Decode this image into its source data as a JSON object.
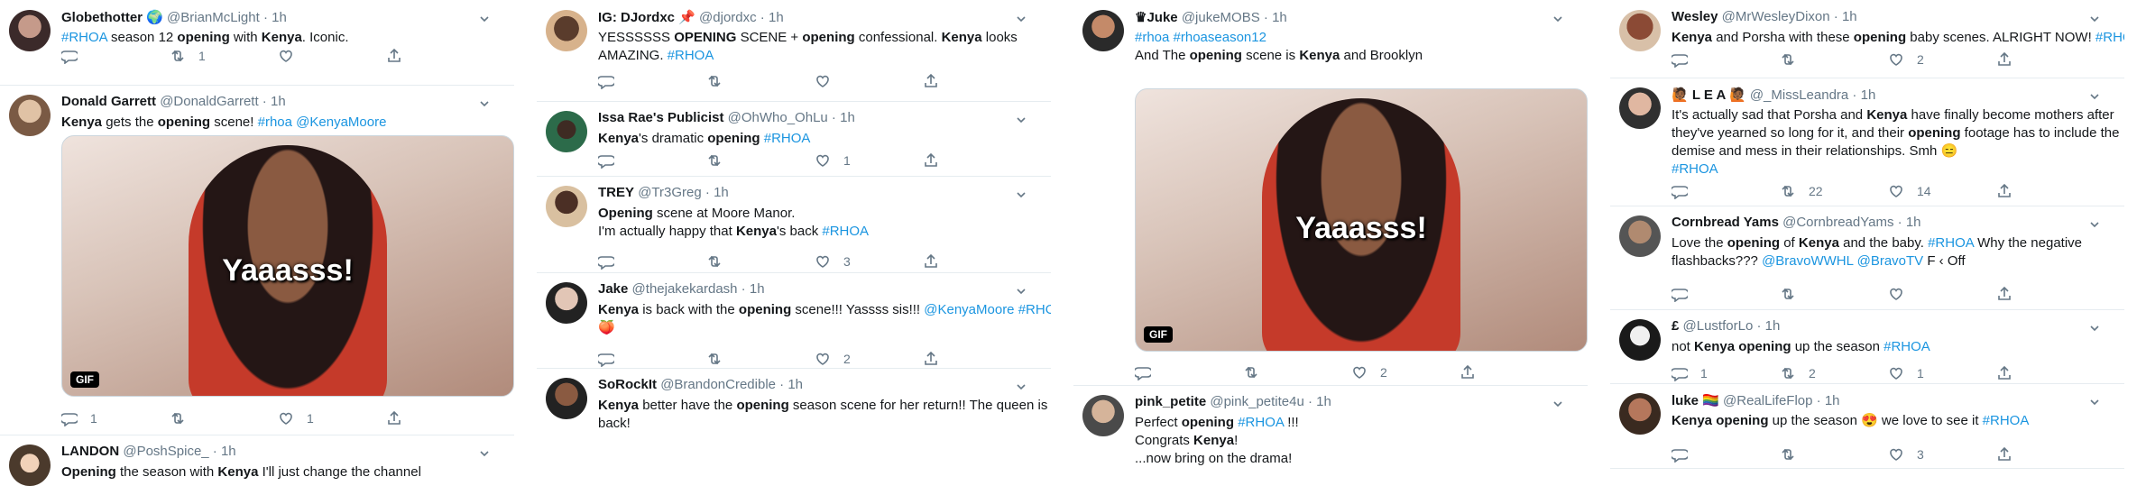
{
  "columns": [
    {
      "tweets": [
        {
          "name": "Globethotter 🌍",
          "handle": "@BrianMcLight",
          "time": "1h",
          "lines": [
            [
              [
                "tag",
                "#RHOA"
              ],
              [
                "t",
                " season 12 "
              ],
              [
                "b",
                "opening"
              ],
              [
                "t",
                " with "
              ],
              [
                "b",
                "Kenya"
              ],
              [
                "t",
                ". Iconic."
              ]
            ]
          ],
          "replies": "",
          "retweets": "1",
          "likes": ""
        },
        {
          "name": "Donald Garrett",
          "handle": "@DonaldGarrett",
          "time": "1h",
          "lines": [
            [
              [
                "b",
                "Kenya"
              ],
              [
                "t",
                " gets the "
              ],
              [
                "b",
                "opening"
              ],
              [
                "t",
                " scene! "
              ],
              [
                "tag",
                "#rhoa"
              ],
              [
                "t",
                " "
              ],
              [
                "tag",
                "@KenyaMoore"
              ]
            ]
          ],
          "gif": {
            "caption": "Yaaasss!",
            "badge": "GIF"
          },
          "replies": "1",
          "retweets": "",
          "likes": "1"
        },
        {
          "name": "LANDON",
          "handle": "@PoshSpice_",
          "time": "1h",
          "lines": [
            [
              [
                "b",
                "Opening"
              ],
              [
                "t",
                " the season with "
              ],
              [
                "b",
                "Kenya"
              ],
              [
                "t",
                " I'll just change the channel"
              ]
            ]
          ]
        }
      ]
    },
    {
      "tweets": [
        {
          "name": "IG: DJordxc 📌",
          "handle": "@djordxc",
          "time": "1h",
          "lines": [
            [
              [
                "t",
                "YESSSSSS "
              ],
              [
                "b",
                "OPENING"
              ],
              [
                "t",
                " SCENE + "
              ],
              [
                "b",
                "opening"
              ],
              [
                "t",
                " confessional. "
              ],
              [
                "b",
                "Kenya"
              ],
              [
                "t",
                " looks"
              ]
            ],
            [
              [
                "t",
                "AMAZING. "
              ],
              [
                "tag",
                "#RHOA"
              ]
            ]
          ],
          "replies": "",
          "retweets": "",
          "likes": ""
        },
        {
          "name": "Issa Rae's Publicist",
          "handle": "@OhWho_OhLu",
          "time": "1h",
          "lines": [
            [
              [
                "b",
                "Kenya"
              ],
              [
                "t",
                "'s dramatic "
              ],
              [
                "b",
                "opening"
              ],
              [
                "t",
                " "
              ],
              [
                "tag",
                "#RHOA"
              ]
            ]
          ],
          "replies": "",
          "retweets": "",
          "likes": "1"
        },
        {
          "name": "TREY",
          "handle": "@Tr3Greg",
          "time": "1h",
          "lines": [
            [
              [
                "b",
                "Opening"
              ],
              [
                "t",
                " scene at Moore Manor."
              ]
            ],
            [
              [
                "t",
                "I'm actually happy that "
              ],
              [
                "b",
                "Kenya"
              ],
              [
                "t",
                "'s back "
              ],
              [
                "tag",
                "#RHOA"
              ]
            ]
          ],
          "replies": "",
          "retweets": "",
          "likes": "3"
        },
        {
          "name": "Jake",
          "handle": "@thejakekardash",
          "time": "1h",
          "lines": [
            [
              [
                "b",
                "Kenya"
              ],
              [
                "t",
                " is back with the "
              ],
              [
                "b",
                "opening"
              ],
              [
                "t",
                " scene!!! Yassss sis!!! "
              ],
              [
                "tag",
                "@KenyaMoore #RHOA"
              ]
            ],
            [
              [
                "t",
                "🍑"
              ]
            ]
          ],
          "replies": "",
          "retweets": "",
          "likes": "2"
        },
        {
          "name": "SoRockIt",
          "handle": "@BrandonCredible",
          "time": "1h",
          "lines": [
            [
              [
                "b",
                "Kenya"
              ],
              [
                "t",
                " better have the "
              ],
              [
                "b",
                "opening"
              ],
              [
                "t",
                "  season scene for her return!! The queen is"
              ]
            ],
            [
              [
                "t",
                "back!"
              ]
            ]
          ]
        }
      ]
    },
    {
      "tweets": [
        {
          "name": "♛Juke",
          "handle": "@jukeMOBS",
          "time": "1h",
          "lines": [
            [
              [
                "tag",
                "#rhoa #rhoaseason12"
              ]
            ],
            [
              [
                "t",
                " "
              ]
            ],
            [
              [
                "t",
                "And The "
              ],
              [
                "b",
                "opening"
              ],
              [
                "t",
                " scene is "
              ],
              [
                "b",
                "Kenya"
              ],
              [
                "t",
                " and Brooklyn"
              ]
            ]
          ],
          "gif": {
            "caption": "Yaaasss!",
            "badge": "GIF"
          },
          "replies": "",
          "retweets": "",
          "likes": "2"
        },
        {
          "name": "pink_petite",
          "handle": "@pink_petite4u",
          "time": "1h",
          "lines": [
            [
              [
                "t",
                "Perfect "
              ],
              [
                "b",
                "opening"
              ],
              [
                "t",
                " "
              ],
              [
                "tag",
                "#RHOA"
              ],
              [
                "t",
                " !!!"
              ]
            ],
            [
              [
                "t",
                "Congrats "
              ],
              [
                "b",
                "Kenya"
              ],
              [
                "t",
                "!"
              ]
            ],
            [
              [
                "t",
                " "
              ]
            ],
            [
              [
                "t",
                "...now bring on the drama!"
              ]
            ]
          ]
        }
      ]
    },
    {
      "tweets": [
        {
          "name": "Wesley",
          "handle": "@MrWesleyDixon",
          "time": "1h",
          "lines": [
            [
              [
                "b",
                "Kenya"
              ],
              [
                "t",
                " and Porsha with these "
              ],
              [
                "b",
                "opening"
              ],
              [
                "t",
                " baby scenes. ALRIGHT NOW! "
              ],
              [
                "tag",
                "#RHOA"
              ]
            ]
          ],
          "replies": "",
          "retweets": "",
          "likes": "2"
        },
        {
          "name": "🙋🏾 L E A 🙋🏾",
          "handle": "@_MissLeandra",
          "time": "1h",
          "lines": [
            [
              [
                "t",
                "It's actually sad that Porsha and "
              ],
              [
                "b",
                "Kenya"
              ],
              [
                "t",
                " have finally become mothers after"
              ]
            ],
            [
              [
                "t",
                "they've yearned so long for it, and their "
              ],
              [
                "b",
                "opening"
              ],
              [
                "t",
                " footage has to include the"
              ]
            ],
            [
              [
                "t",
                "demise and mess in their relationships. Smh 😑"
              ]
            ],
            [
              [
                "tag",
                "#RHOA"
              ]
            ]
          ],
          "replies": "",
          "retweets": "22",
          "likes": "14"
        },
        {
          "name": "Cornbread Yams",
          "handle": "@CornbreadYams",
          "time": "1h",
          "lines": [
            [
              [
                "t",
                "Love the "
              ],
              [
                "b",
                "opening"
              ],
              [
                "t",
                " of "
              ],
              [
                "b",
                "Kenya"
              ],
              [
                "t",
                " and the baby. "
              ],
              [
                "tag",
                "#RHOA"
              ],
              [
                "t",
                " Why the negative"
              ]
            ],
            [
              [
                "t",
                "flashbacks??? "
              ],
              [
                "tag",
                "@BravoWWHL @BravoTV"
              ],
              [
                "t",
                " F    ‹ Off"
              ]
            ]
          ],
          "replies": "",
          "retweets": "",
          "likes": ""
        },
        {
          "name": "£",
          "handle": "@LustforLo",
          "time": "1h",
          "lines": [
            [
              [
                "t",
                "not "
              ],
              [
                "b",
                "Kenya opening"
              ],
              [
                "t",
                " up the season "
              ],
              [
                "tag",
                "#RHOA"
              ]
            ]
          ],
          "replies": "1",
          "retweets": "2",
          "likes": "1"
        },
        {
          "name": "luke 🏳️‍🌈",
          "handle": "@RealLifeFlop",
          "time": "1h",
          "lines": [
            [
              [
                "b",
                "Kenya opening"
              ],
              [
                "t",
                " up the season 😍 we love to see it "
              ],
              [
                "tag",
                "#RHOA"
              ]
            ]
          ],
          "replies": "",
          "retweets": "",
          "likes": "3"
        }
      ]
    }
  ]
}
